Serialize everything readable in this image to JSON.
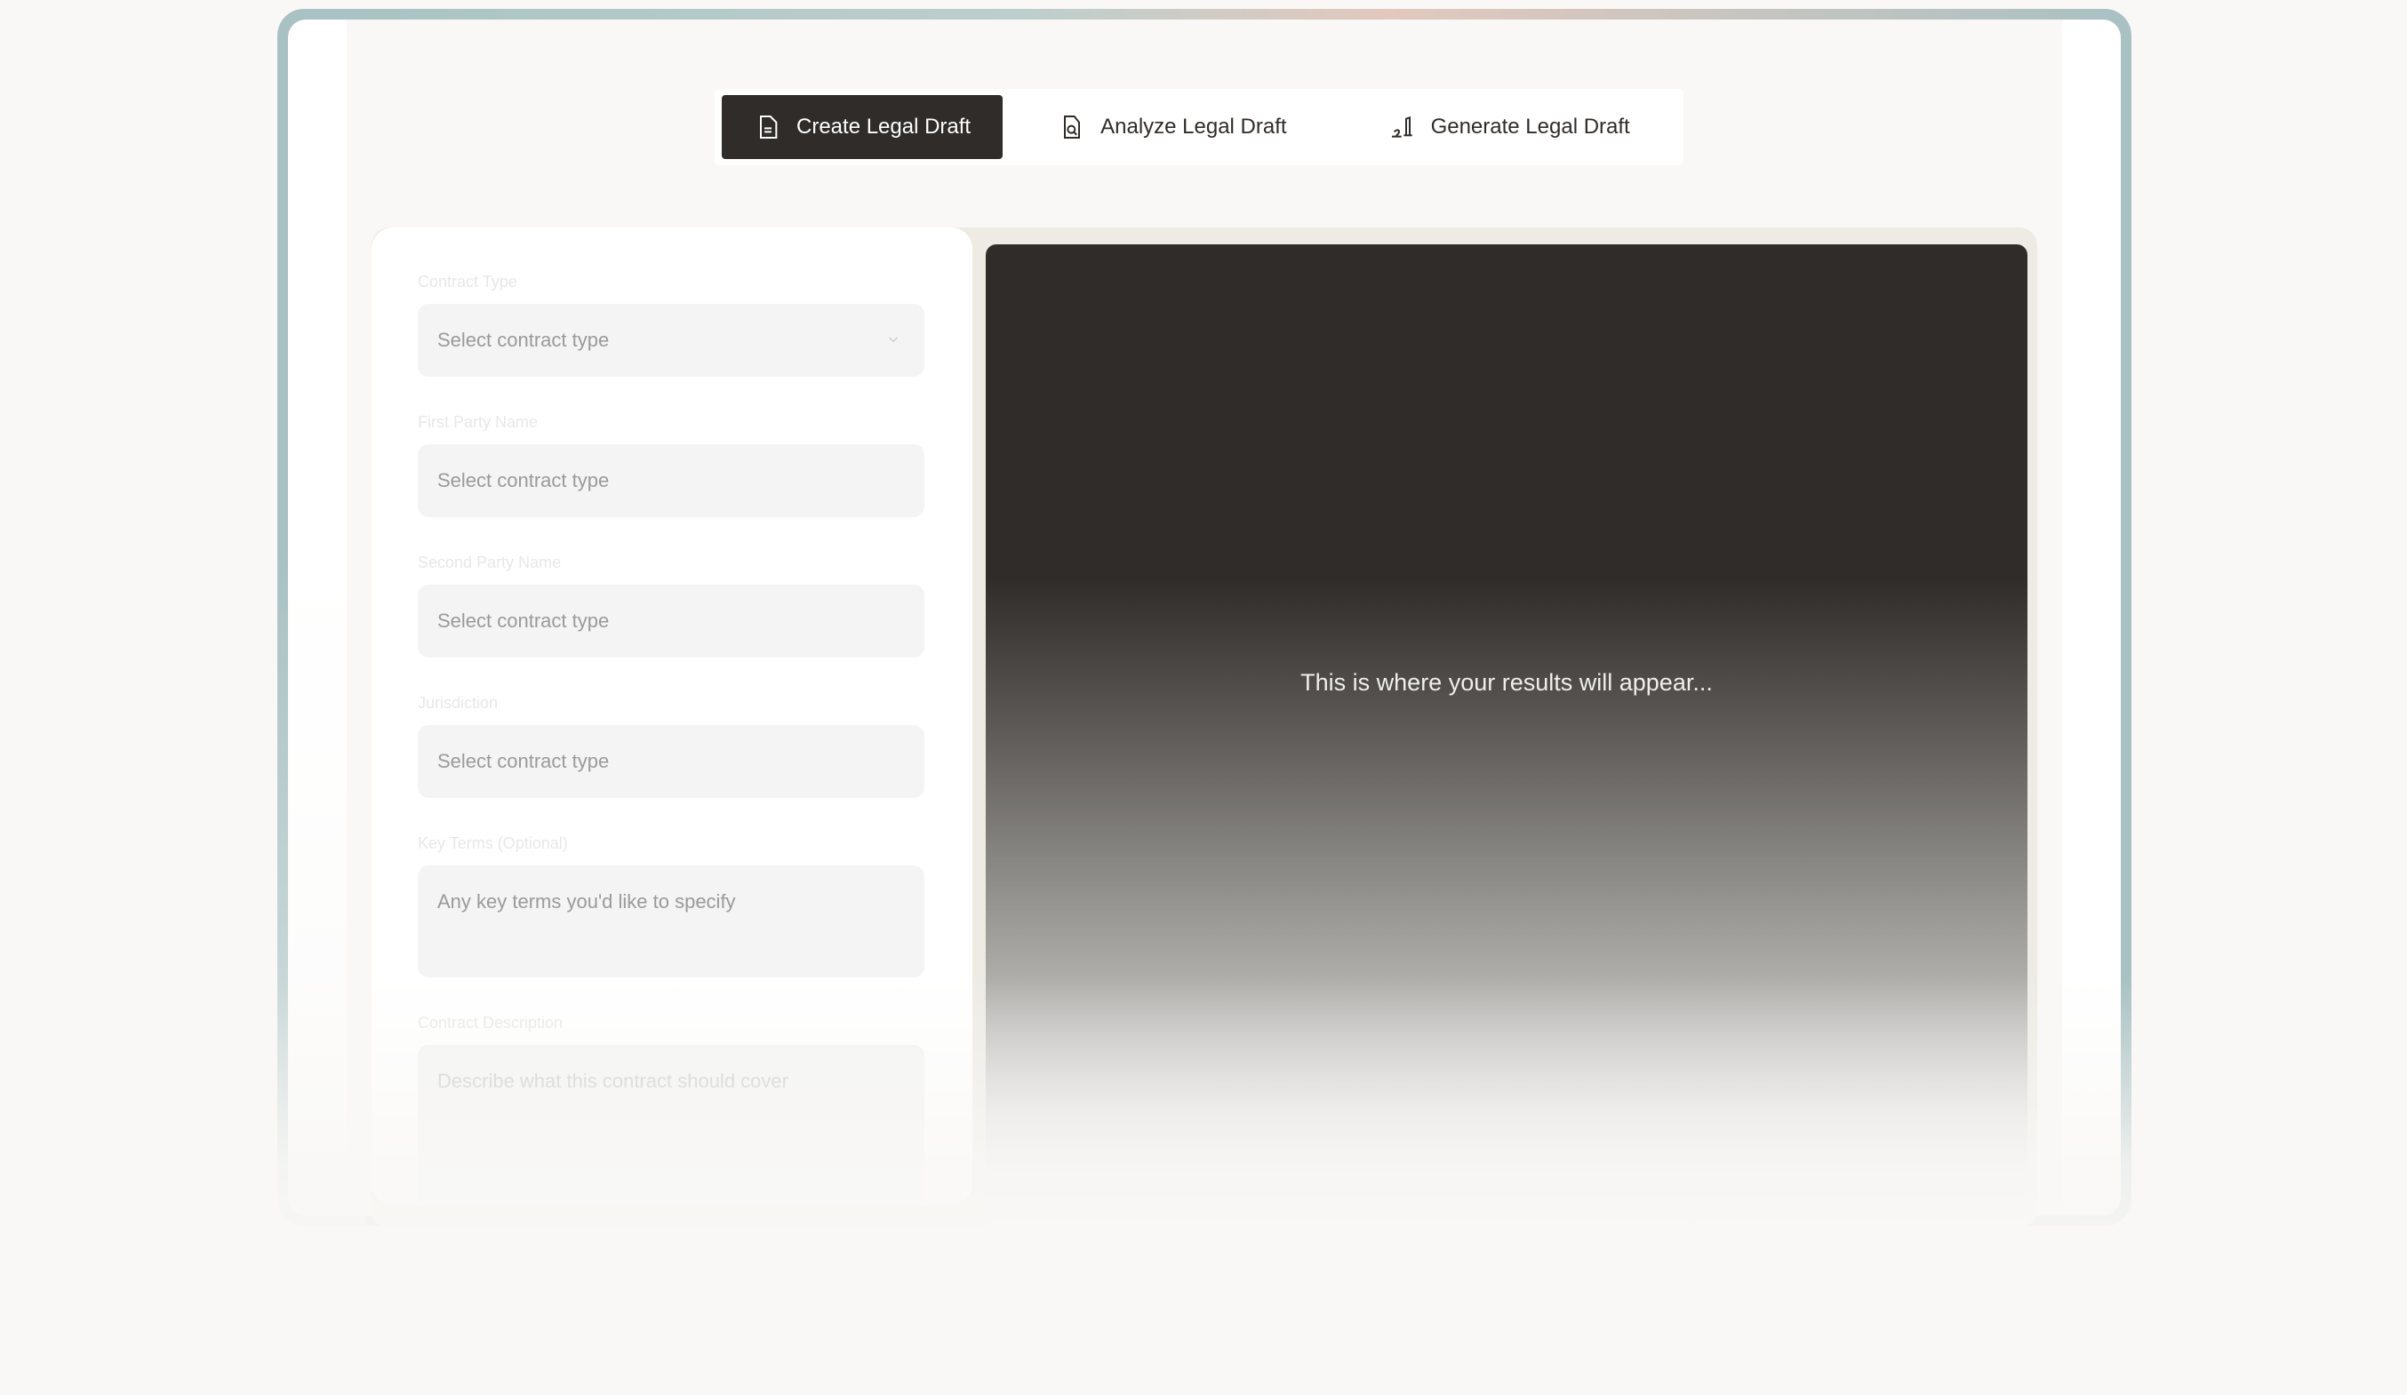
{
  "tabs": [
    {
      "label": "Create Legal Draft",
      "icon": "document-icon",
      "active": true
    },
    {
      "label": "Analyze Legal Draft",
      "icon": "document-search-icon",
      "active": false
    },
    {
      "label": "Generate Legal Draft",
      "icon": "signature-icon",
      "active": false
    }
  ],
  "form": {
    "contract_type": {
      "label": "Contract Type",
      "placeholder": "Select contract type"
    },
    "first_party": {
      "label": "First Party Name",
      "placeholder": "Select contract type"
    },
    "second_party": {
      "label": "Second Party Name",
      "placeholder": "Select contract type"
    },
    "jurisdiction": {
      "label": "Jurisdiction",
      "placeholder": "Select contract type"
    },
    "key_terms": {
      "label": "Key Terms (Optional)",
      "placeholder": "Any key terms you'd like to specify"
    },
    "description": {
      "label": "Contract Description",
      "placeholder": "Describe what this contract should cover"
    }
  },
  "results": {
    "placeholder": "This is where your results will appear..."
  },
  "colors": {
    "accent_dark": "#2f2c29",
    "background": "#f9f8f6",
    "field_bg": "#f4f4f4"
  }
}
